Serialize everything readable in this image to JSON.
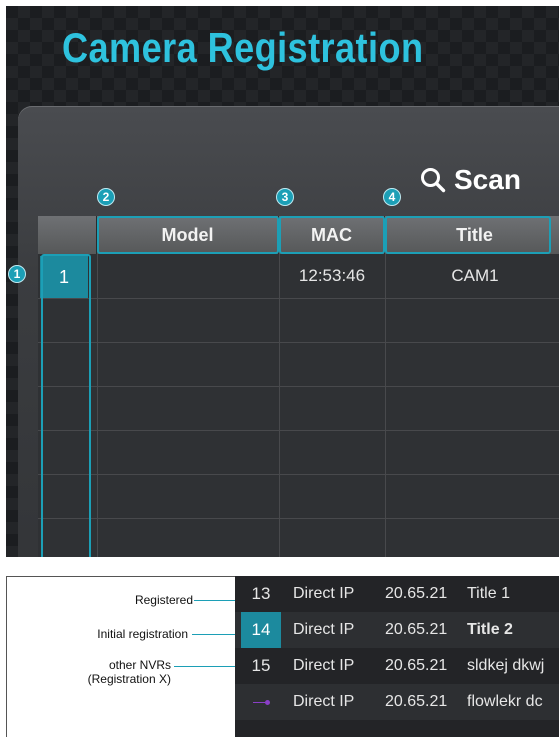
{
  "top": {
    "title": "Camera Registration",
    "scan_label": "Scan",
    "columns": {
      "model": "Model",
      "mac": "MAC",
      "title": "Title"
    },
    "rows": [
      {
        "num": "1",
        "model": "",
        "mac": "12:53:46",
        "title": "CAM1"
      }
    ],
    "markers": [
      "1",
      "2",
      "3",
      "4"
    ],
    "accent_color": "#1c9fb6",
    "title_color": "#2ec2de"
  },
  "bottom": {
    "legend": {
      "registered": "Registered",
      "initial": "Initial registration",
      "other_line1": "other NVRs",
      "other_line2": "(Registration X)"
    },
    "rows": [
      {
        "num": "13",
        "type": "Direct IP",
        "version": "20.65.21",
        "title": "Title 1"
      },
      {
        "num": "14",
        "type": "Direct IP",
        "version": "20.65.21",
        "title": "Title 2"
      },
      {
        "num": "15",
        "type": "Direct IP",
        "version": "20.65.21",
        "title": "sldkej dkwj"
      },
      {
        "num": "",
        "type": "Direct IP",
        "version": "20.65.21",
        "title": "flowlekr dc"
      }
    ]
  }
}
